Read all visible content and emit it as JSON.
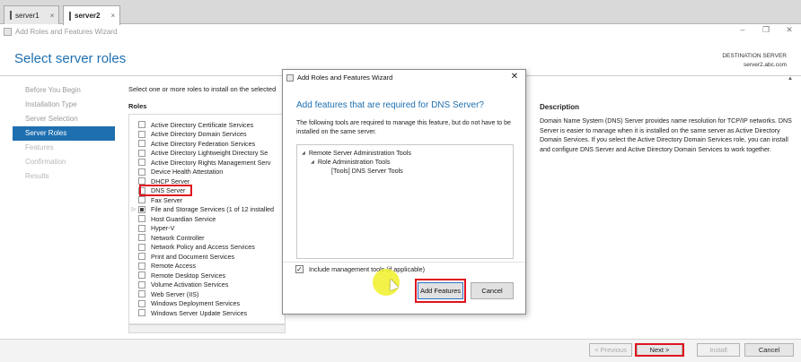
{
  "browser_tabs": [
    {
      "label": "server1",
      "close": "×"
    },
    {
      "label": "server2",
      "close": "×",
      "active": true
    }
  ],
  "wizard": {
    "window_title": "Add Roles and Features Wizard",
    "window_controls": [
      "–",
      "❐",
      "✕"
    ],
    "page_heading": "Select server roles",
    "destination_label": "DESTINATION SERVER",
    "destination_value": "server2.abc.com",
    "nav": [
      {
        "label": "Before You Begin",
        "state": "done"
      },
      {
        "label": "Installation Type",
        "state": "done"
      },
      {
        "label": "Server Selection",
        "state": "done"
      },
      {
        "label": "Server Roles",
        "state": "current"
      },
      {
        "label": "Features",
        "state": "pending"
      },
      {
        "label": "Confirmation",
        "state": "pending"
      },
      {
        "label": "Results",
        "state": "pending"
      }
    ],
    "instruction": "Select one or more roles to install on the selected",
    "roles_heading": "Roles",
    "roles": [
      {
        "label": "Active Directory Certificate Services",
        "state": "unchecked"
      },
      {
        "label": "Active Directory Domain Services",
        "state": "unchecked"
      },
      {
        "label": "Active Directory Federation Services",
        "state": "unchecked"
      },
      {
        "label": "Active Directory Lightweight Directory Se",
        "state": "unchecked"
      },
      {
        "label": "Active Directory Rights Management Serv",
        "state": "unchecked"
      },
      {
        "label": "Device Health Attestation",
        "state": "unchecked"
      },
      {
        "label": "DHCP Server",
        "state": "unchecked"
      },
      {
        "label": "DNS Server",
        "state": "unchecked"
      },
      {
        "label": "Fax Server",
        "state": "unchecked"
      },
      {
        "label": "File and Storage Services (1 of 12 installed",
        "state": "partial",
        "expandable": true
      },
      {
        "label": "Host Guardian Service",
        "state": "unchecked"
      },
      {
        "label": "Hyper-V",
        "state": "unchecked"
      },
      {
        "label": "Network Controller",
        "state": "unchecked"
      },
      {
        "label": "Network Policy and Access Services",
        "state": "unchecked"
      },
      {
        "label": "Print and Document Services",
        "state": "unchecked"
      },
      {
        "label": "Remote Access",
        "state": "unchecked"
      },
      {
        "label": "Remote Desktop Services",
        "state": "unchecked"
      },
      {
        "label": "Volume Activation Services",
        "state": "unchecked"
      },
      {
        "label": "Web Server (IIS)",
        "state": "unchecked"
      },
      {
        "label": "Windows Deployment Services",
        "state": "unchecked"
      },
      {
        "label": "Windows Server Update Services",
        "state": "unchecked"
      }
    ],
    "description_heading": "Description",
    "description_text": "Domain Name System (DNS) Server provides name resolution for TCP/IP networks. DNS Server is easier to manage when it is installed on the same server as Active Directory Domain Services. If you select the Active Directory Domain Services role, you can install and configure DNS Server and Active Directory Domain Services to work together.",
    "footer_buttons": {
      "previous": "< Previous",
      "next": "Next >",
      "install": "Install",
      "cancel": "Cancel"
    }
  },
  "dialog": {
    "title": "Add Roles and Features Wizard",
    "close": "✕",
    "heading": "Add features that are required for DNS Server?",
    "body": "The following tools are required to manage this feature, but do not have to be installed on the same server.",
    "tree": [
      {
        "label": "Remote Server Administration Tools",
        "level": 0
      },
      {
        "label": "Role Administration Tools",
        "level": 1
      },
      {
        "label": "[Tools] DNS Server Tools",
        "level": 2
      }
    ],
    "include_label": "Include management tools (if applicable)",
    "include_checked": true,
    "add_button": "Add Features",
    "cancel_button": "Cancel"
  },
  "colors": {
    "accent": "#1e6fb0",
    "highlight": "#e0141f",
    "cursor_halo": "#f0f028"
  }
}
